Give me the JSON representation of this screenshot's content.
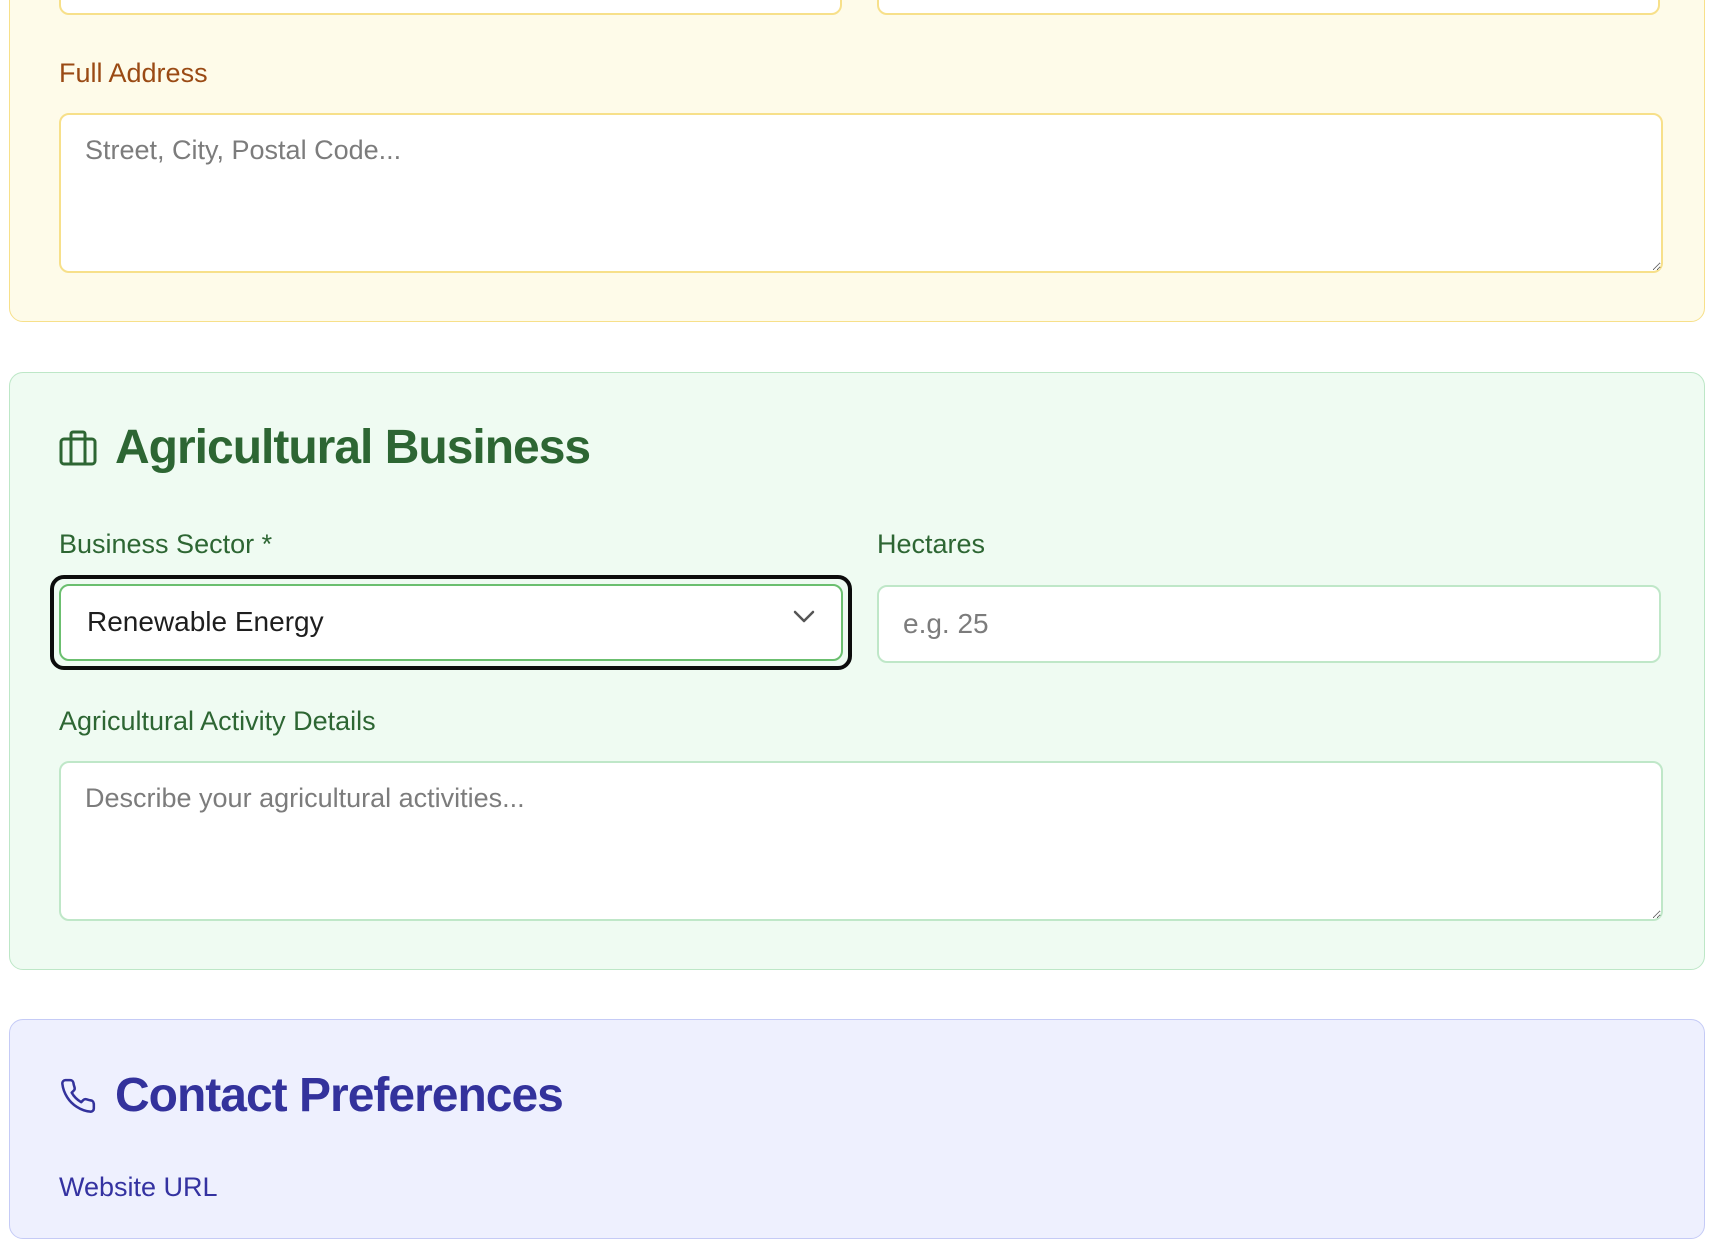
{
  "address_section": {
    "full_address_label": "Full Address",
    "full_address_placeholder": "Street, City, Postal Code...",
    "full_address_value": ""
  },
  "business_section": {
    "title": "Agricultural Business",
    "icon": "briefcase-icon",
    "sector_label": "Business Sector *",
    "sector_value": "Renewable Energy",
    "hectares_label": "Hectares",
    "hectares_placeholder": "e.g. 25",
    "hectares_value": "",
    "activity_label": "Agricultural Activity Details",
    "activity_placeholder": "Describe your agricultural activities...",
    "activity_value": ""
  },
  "contact_section": {
    "title": "Contact Preferences",
    "icon": "phone-icon",
    "website_label": "Website URL"
  },
  "colors": {
    "amber_bg": "#fefbe9",
    "amber_border": "#f7e08a",
    "green_bg": "#effbf2",
    "green_text": "#2d6633",
    "indigo_bg": "#eef0fe",
    "indigo_text": "#33329c"
  }
}
